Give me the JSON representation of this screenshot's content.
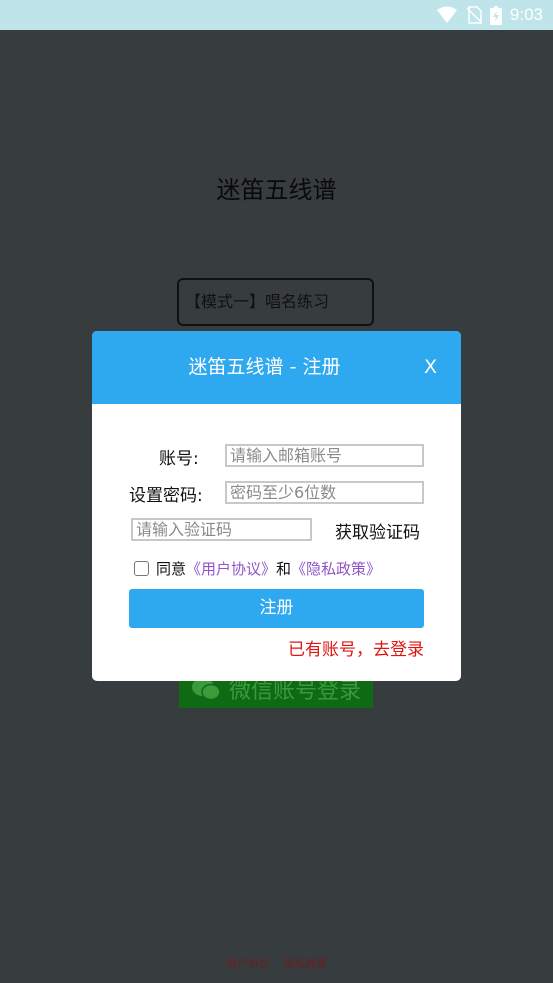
{
  "status_bar": {
    "time": "9:03"
  },
  "app": {
    "title": "迷笛五线谱",
    "mode_button": "【模式一】唱名练习",
    "wechat_login": "微信账号登录",
    "footer": {
      "user_agreement": "用户协议",
      "privacy_policy": "隐私政策"
    }
  },
  "modal": {
    "title": "迷笛五线谱 - 注册",
    "close_label": "X",
    "account_label": "账号:",
    "account_placeholder": "请输入邮箱账号",
    "password_label": "设置密码:",
    "password_placeholder": "密码至少6位数",
    "code_placeholder": "请输入验证码",
    "get_code_label": "获取验证码",
    "agree_prefix": "同意",
    "agree_user_agreement": "《用户协议》",
    "agree_and": "和",
    "agree_privacy": "《隐私政策》",
    "agree_checked": false,
    "register_label": "注册",
    "to_login_label": "已有账号，去登录"
  },
  "colors": {
    "accent": "#2ea8ef",
    "link": "#8f55c8",
    "login_link": "#e01414"
  }
}
